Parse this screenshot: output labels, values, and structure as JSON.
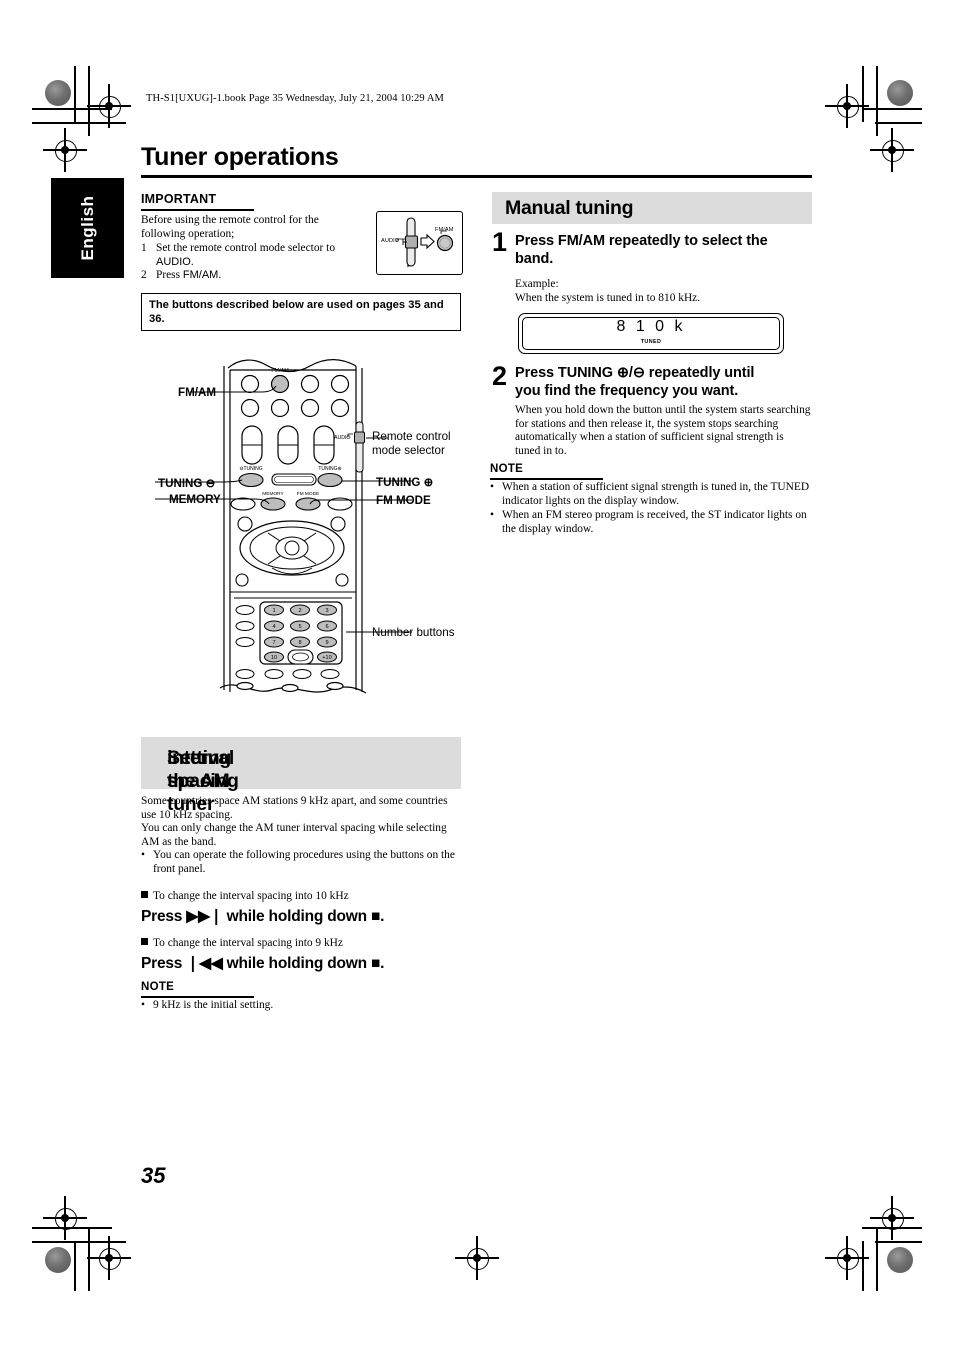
{
  "document": {
    "file_header": "TH-S1[UXUG]-1.book  Page 35  Wednesday, July 21, 2004  10:29 AM",
    "language_tab": "English",
    "page_title": "Tuner operations",
    "page_number": "35"
  },
  "important": {
    "heading": "IMPORTANT",
    "lead": "Before using the remote control for the following operation;",
    "steps": [
      {
        "num": "1",
        "text_a": "Set the remote control mode selector to ",
        "text_b": "AUDIO",
        "text_c": "."
      },
      {
        "num": "2",
        "text_a": "Press ",
        "text_b": "FM/AM",
        "text_c": "."
      }
    ],
    "selector_figure": {
      "left_label": "AUDIO",
      "right_label": "FM/AM"
    }
  },
  "notice_box": {
    "text": "The buttons described below are used on pages 35 and 36."
  },
  "remote_figure": {
    "callouts": {
      "fm_am": "FM/AM",
      "tuning_minus": "TUNING ⊖",
      "memory": "MEMORY",
      "tuning_plus": "TUNING ⊕",
      "fm_mode": "FM MODE",
      "mode_selector_line1": "Remote control",
      "mode_selector_line2": "mode selector",
      "number_buttons": "Number buttons"
    },
    "button_glyphs": {
      "fm_am": "FM/AM",
      "tuning_minus": "TUNING",
      "tuning_plus": "TUNING",
      "memory": "MEMORY",
      "fm_mode": "FM MODE",
      "audio": "AUDIO"
    },
    "number_keys": [
      "1",
      "2",
      "3",
      "4",
      "5",
      "6",
      "7",
      "8",
      "9",
      "10",
      "+10"
    ]
  },
  "am_section": {
    "heading_line1": "Setting the AM tuner",
    "heading_line2": "interval spacing",
    "paragraphs": [
      "Some countries space AM stations 9 kHz apart, and some countries use 10 kHz spacing.",
      "You can only change the AM tuner interval spacing while selecting AM as the band."
    ],
    "bullets": [
      "You can operate the following procedures using the buttons on the front panel."
    ],
    "subsections": [
      {
        "title": "To change the interval spacing into 10 kHz",
        "instruction_pre": "Press ",
        "instruction_icon": "▶▶❘",
        "instruction_mid": " while holding down ",
        "instruction_stop": "■",
        "instruction_post": "."
      },
      {
        "title": "To change the interval spacing into 9 kHz",
        "instruction_pre": "Press ",
        "instruction_icon": "❘◀◀",
        "instruction_mid": " while holding down ",
        "instruction_stop": "■",
        "instruction_post": "."
      }
    ],
    "note": {
      "heading": "NOTE",
      "items": [
        "9 kHz is the initial setting."
      ]
    }
  },
  "manual_tuning": {
    "heading": "Manual tuning",
    "steps": [
      {
        "num": "1",
        "head_line1": "Press FM/AM repeatedly to select the",
        "head_line2": "band.",
        "body_line1": "Example:",
        "body_line2": "When the system is tuned in to 810 kHz."
      },
      {
        "num": "2",
        "head_line1": "Press TUNING ⊕/⊖ repeatedly until",
        "head_line2": "you find the frequency you want.",
        "body": "When you hold down the button until the system starts searching for stations and then release it, the system stops searching automatically when a station of sufficient signal strength is tuned in to."
      }
    ],
    "display": {
      "value": "8 1 0 k",
      "indicator": "TUNED"
    },
    "note": {
      "heading": "NOTE",
      "items": [
        "When a station of sufficient signal strength is tuned in, the TUNED indicator lights on the display window.",
        "When an FM stereo program is received, the ST indicator lights on the display window."
      ]
    }
  },
  "colors": {
    "section_header_bg": "#dcdcdc",
    "tab_bg": "#000000",
    "button_fill": "#bdbdbd",
    "text": "#000000"
  }
}
